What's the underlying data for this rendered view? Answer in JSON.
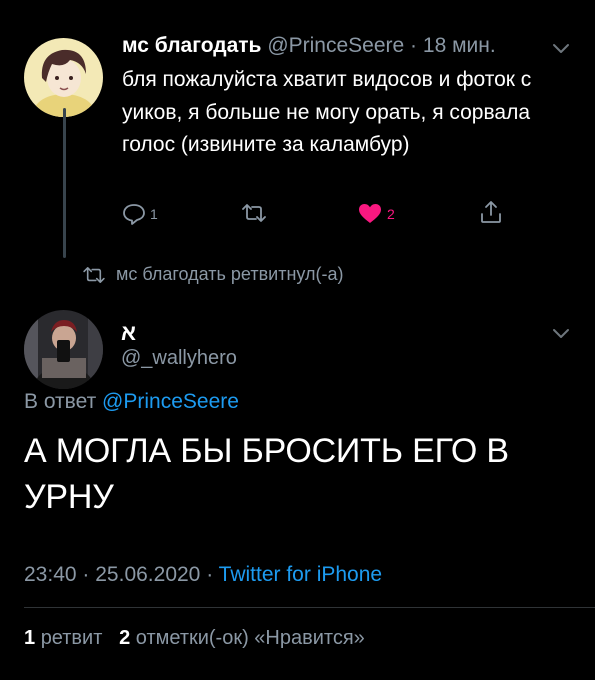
{
  "colors": {
    "background": "#000000",
    "text": "#ffffff",
    "secondary": "#8b98a5",
    "link": "#1d9bf0",
    "like": "#f91880",
    "divider": "#2f3336"
  },
  "parent_tweet": {
    "display_name": "мс благодать",
    "handle": "@PrinceSeere",
    "separator": "·",
    "time_ago": "18 мин.",
    "text": "бля пожалуйста хватит видосов и фоток с уиков, я больше не могу орать, я сорвала голос (извините за каламбур)",
    "reply_count": "1",
    "retweet_count": "",
    "like_count": "2",
    "liked": true,
    "icons": [
      "reply-icon",
      "retweet-icon",
      "heart-icon",
      "share-icon",
      "chevron-down-icon"
    ]
  },
  "retweet_note": {
    "text": "мс благодать ретвитнул(-а)",
    "icon": "retweet-icon"
  },
  "main_tweet": {
    "display_name": "א",
    "handle": "@_wallyhero",
    "reply_prefix": "В ответ",
    "reply_to": "@PrinceSeere",
    "text": "А МОГЛА БЫ БРОСИТЬ ЕГО В УРНУ",
    "time": "23:40",
    "date": "25.06.2020",
    "separator": "·",
    "source": "Twitter for iPhone",
    "stats": {
      "retweets_count": "1",
      "retweets_label": "ретвит",
      "likes_count": "2",
      "likes_label": "отметки(-ок) «Нравится»"
    }
  }
}
